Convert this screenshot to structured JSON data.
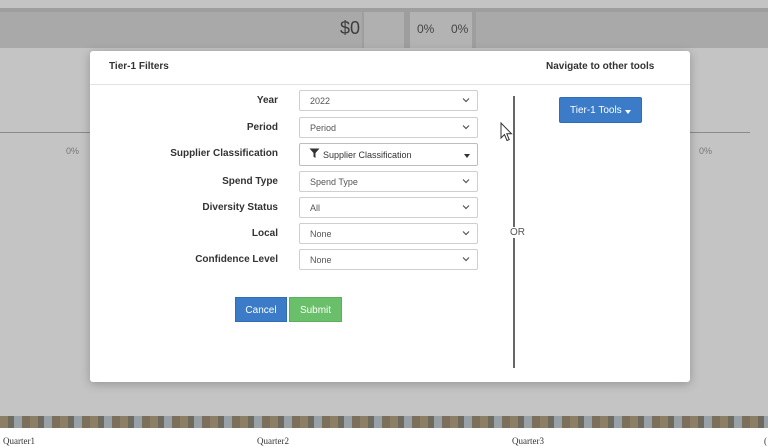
{
  "background": {
    "kpi_value": "$0",
    "kpi_pct_1": "0%",
    "kpi_pct_2": "0%",
    "side_pct_left": "0%",
    "side_pct_right": "0%",
    "axis_labels": [
      "Quarter1",
      "Quarter2",
      "Quarter3",
      "("
    ]
  },
  "modal": {
    "title": "Tier-1 Filters",
    "nav_title": "Navigate to other tools",
    "filters": [
      {
        "label": "Year",
        "value": "2022",
        "icon": "chevron-down-icon"
      },
      {
        "label": "Period",
        "value": "Period",
        "icon": "chevron-down-icon"
      },
      {
        "label": "Supplier Classification",
        "value": "Supplier Classification",
        "icon": "caret-down-icon",
        "prefix_icon": "filter-icon"
      },
      {
        "label": "Spend Type",
        "value": "Spend Type",
        "icon": "chevron-down-icon"
      },
      {
        "label": "Diversity Status",
        "value": "All",
        "icon": "chevron-down-icon"
      },
      {
        "label": "Local",
        "value": "None",
        "icon": "chevron-down-icon"
      },
      {
        "label": "Confidence Level",
        "value": "None",
        "icon": "chevron-down-icon"
      }
    ],
    "cancel_label": "Cancel",
    "submit_label": "Submit",
    "or_label": "OR",
    "tools_button_label": "Tier-1 Tools",
    "colors": {
      "primary": "#3b7bc8",
      "success": "#6abf6a"
    }
  }
}
